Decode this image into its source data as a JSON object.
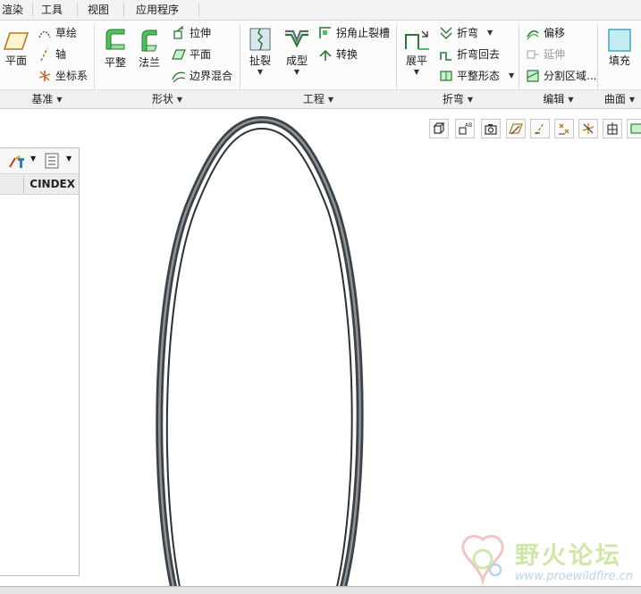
{
  "menu": {
    "items": [
      {
        "id": "render",
        "label": "渲染"
      },
      {
        "id": "tools",
        "label": "工具"
      },
      {
        "id": "view",
        "label": "视图"
      },
      {
        "id": "apps",
        "label": "应用程序"
      }
    ]
  },
  "ribbon": {
    "groups": [
      {
        "id": "datum",
        "label": "基准"
      },
      {
        "id": "shapes",
        "label": "形状"
      },
      {
        "id": "engineering",
        "label": "工程"
      },
      {
        "id": "bend",
        "label": "折弯"
      },
      {
        "id": "edit",
        "label": "编辑"
      },
      {
        "id": "surface",
        "label": "曲面"
      }
    ],
    "datum": {
      "plane": "平面",
      "sketch": "草绘",
      "axis": "轴",
      "csys": "坐标系"
    },
    "shapes": {
      "flat": "平整",
      "flange": "法兰",
      "extrude": "拉伸",
      "planar": "平面",
      "boundary_blend": "边界混合"
    },
    "engineering": {
      "rip": "扯裂",
      "form": "成型",
      "corner_relief": "拐角止裂槽",
      "convert": "转换"
    },
    "bend": {
      "unbend": "展平",
      "bend": "折弯",
      "bend_back": "折弯回去",
      "flat_state": "平整形态"
    },
    "edit": {
      "offset": "偏移",
      "extend": "延伸",
      "split_area": "分割区域..."
    },
    "surface": {
      "fill": "填充"
    }
  },
  "panel": {
    "column_header": "CINDEX"
  },
  "watermark": {
    "title": "野火论坛",
    "url": "www.proewildfire.cn"
  },
  "colors": {
    "ring": "#3d4246",
    "ring_highlight": "#8c949a",
    "accent_green": "#3aa84a",
    "watermark_green": "#cfe7a6",
    "watermark_blue": "#b9d2ee"
  }
}
